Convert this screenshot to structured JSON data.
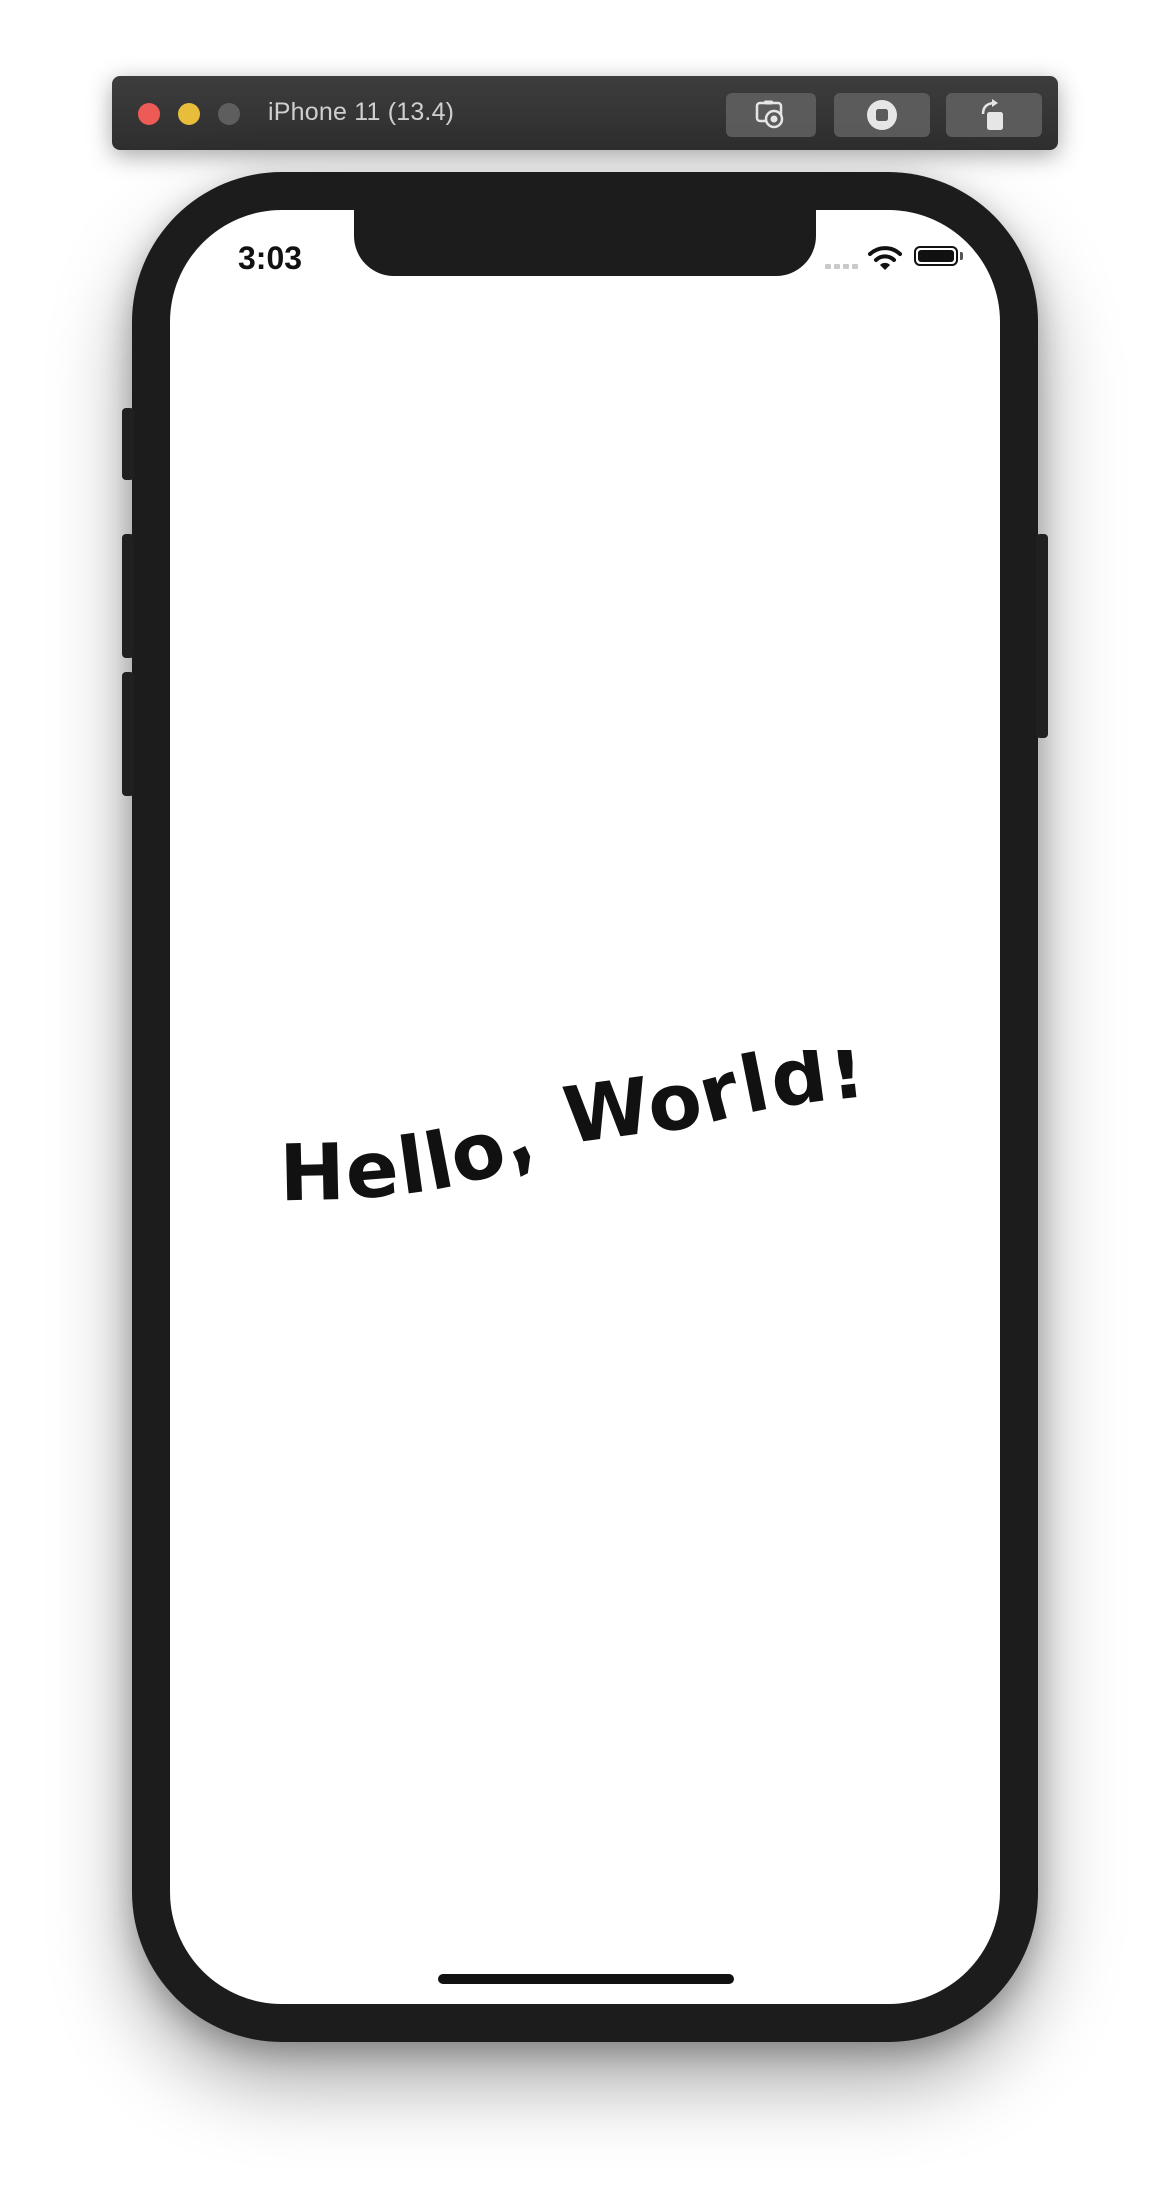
{
  "window": {
    "title": "iPhone 11 (13.4)",
    "toolbar": {
      "screenshot_icon": "camera-icon",
      "home_icon": "home-icon",
      "rotate_icon": "rotate-icon"
    },
    "traffic_lights": {
      "close_color": "#ee5b57",
      "minimize_color": "#e7bd3b",
      "zoom_color": "#5e5e5e"
    }
  },
  "status_bar": {
    "time": "3:03",
    "signal_icon": "cellular-signal-icon",
    "wifi_icon": "wifi-icon",
    "battery_icon": "battery-icon",
    "battery_level": 1.0
  },
  "content": {
    "greeting": "Hello, World!"
  },
  "colors": {
    "device_frame": "#1c1c1c",
    "screen_background": "#ffffff",
    "text": "#111111"
  }
}
